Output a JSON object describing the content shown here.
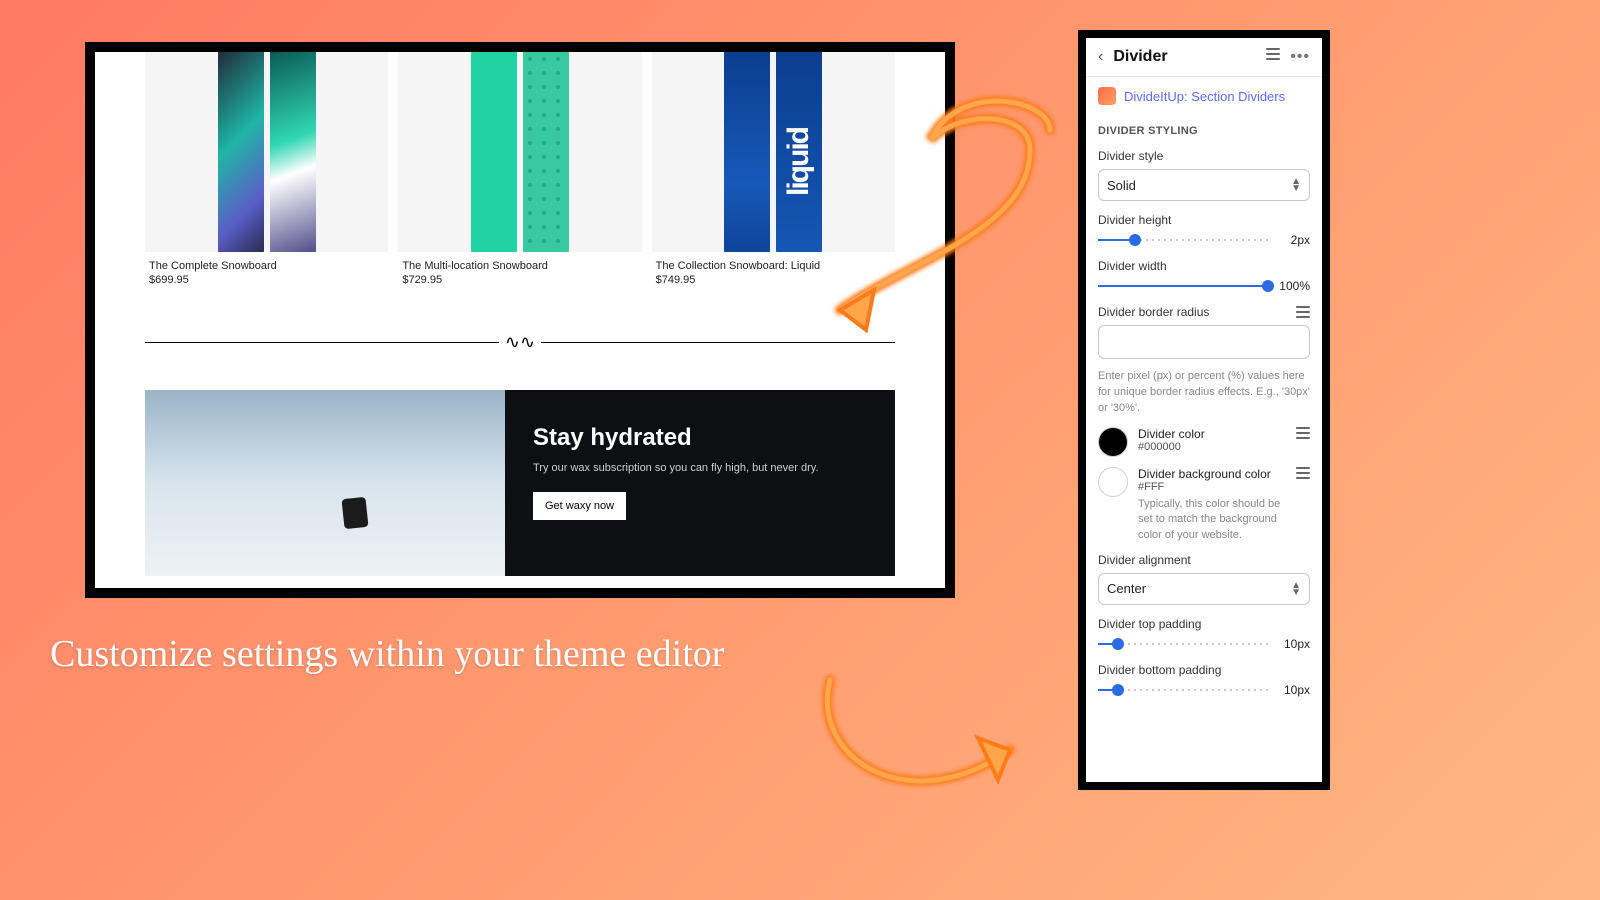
{
  "caption": "Customize settings within your theme editor",
  "preview": {
    "products": [
      {
        "title": "The Complete Snowboard",
        "price": "$699.95"
      },
      {
        "title": "The Multi-location Snowboard",
        "price": "$729.95"
      },
      {
        "title": "The Collection Snowboard: Liquid",
        "price": "$749.95"
      }
    ],
    "hero": {
      "title": "Stay hydrated",
      "subtitle": "Try our wax subscription so you can fly high, but never dry.",
      "button": "Get waxy now"
    }
  },
  "panel": {
    "title": "Divider",
    "app_name": "DivideItUp: Section Dividers",
    "section_heading": "DIVIDER STYLING",
    "style": {
      "label": "Divider style",
      "value": "Solid"
    },
    "height": {
      "label": "Divider height",
      "value": "2px",
      "percent": 22
    },
    "width": {
      "label": "Divider width",
      "value": "100%",
      "percent": 100
    },
    "border_radius": {
      "label": "Divider border radius",
      "value": "",
      "help": "Enter pixel (px) or percent (%) values here for unique border radius effects. E.g., '30px' or '30%'."
    },
    "divider_color": {
      "label": "Divider color",
      "hex": "#000000",
      "swatch": "#000000"
    },
    "bg_color": {
      "label": "Divider background color",
      "hex": "#FFF",
      "swatch": "#ffffff",
      "help": "Typically, this color should be set to match the background color of your website."
    },
    "alignment": {
      "label": "Divider alignment",
      "value": "Center"
    },
    "top_padding": {
      "label": "Divider top padding",
      "value": "10px",
      "percent": 12
    },
    "bottom_padding": {
      "label": "Divider bottom padding",
      "value": "10px",
      "percent": 12
    }
  }
}
